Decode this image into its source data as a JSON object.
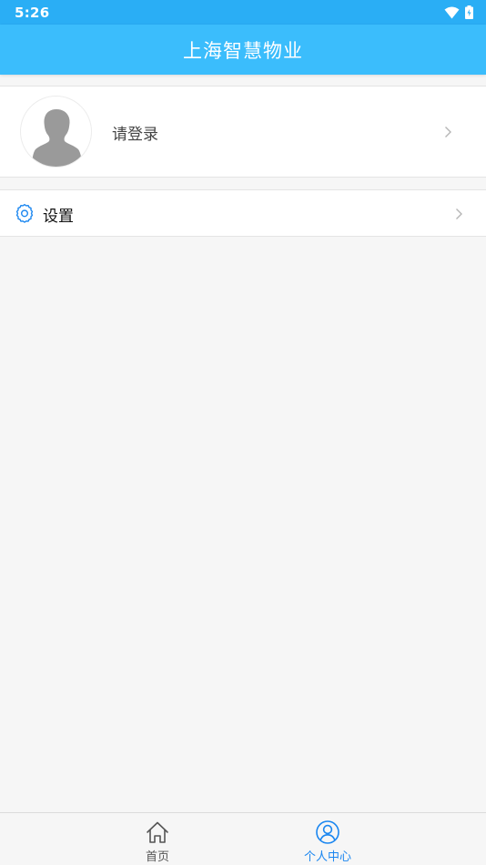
{
  "status_bar": {
    "time": "5:26",
    "icons": [
      "wifi-icon",
      "battery-icon"
    ]
  },
  "app_bar": {
    "title": "上海智慧物业"
  },
  "profile": {
    "login_prompt": "请登录",
    "avatar_icon": "default-avatar-icon",
    "chevron_icon": "chevron-right-icon"
  },
  "settings": {
    "label": "设置",
    "icon": "gear-icon",
    "chevron_icon": "chevron-right-icon"
  },
  "bottom_nav": {
    "items": [
      {
        "label": "首页",
        "icon": "home-icon",
        "active": false
      },
      {
        "label": "个人中心",
        "icon": "user-icon",
        "active": true
      }
    ]
  },
  "colors": {
    "status_bar": "#2aaef5",
    "app_bar": "#3bbdfc",
    "active_tab": "#1a86f0",
    "inactive_tab": "#555555",
    "background": "#f6f6f6"
  }
}
